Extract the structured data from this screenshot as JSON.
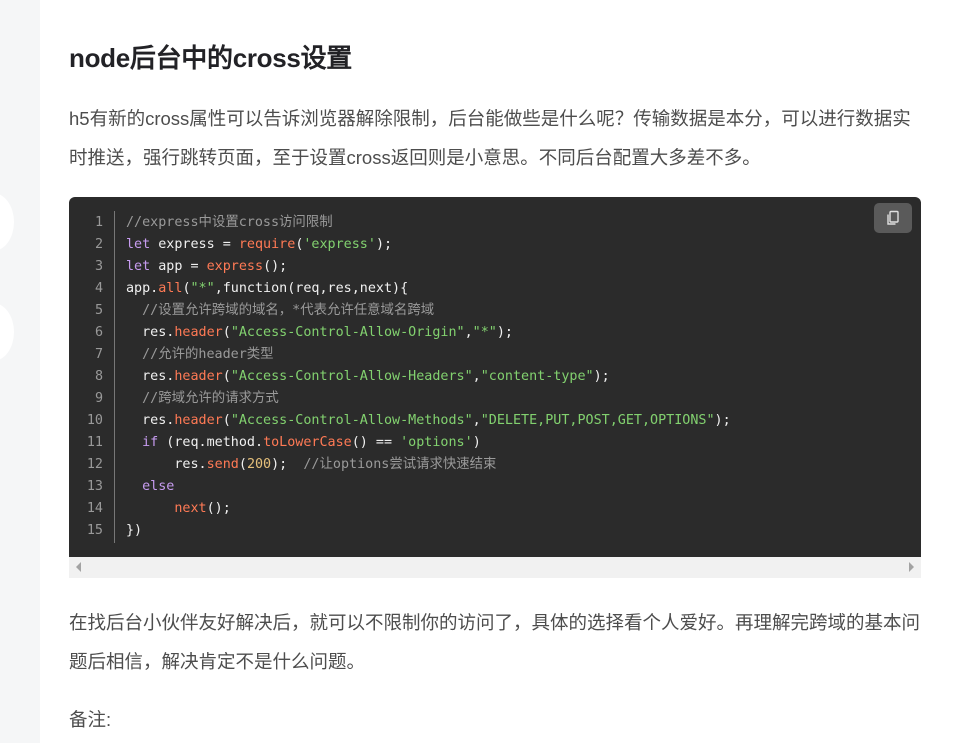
{
  "article": {
    "title": "node后台中的cross设置",
    "intro": "h5有新的cross属性可以告诉浏览器解除限制，后台能做些是什么呢？传输数据是本分，可以进行数据实时推送，强行跳转页面，至于设置cross返回则是小意思。不同后台配置大多差不多。",
    "conclusion": "在找后台小伙伴友好解决后，就可以不限制你的访问了，具体的选择看个人爱好。再理解完跨域的基本问题后相信，解决肯定不是什么问题。",
    "note_label": "备注:"
  },
  "code_block": {
    "copy_icon": "copy-icon",
    "lines": [
      {
        "n": "1",
        "tokens": [
          [
            "cm",
            "//express中设置cross访问限制"
          ]
        ]
      },
      {
        "n": "2",
        "tokens": [
          [
            "kw",
            "let"
          ],
          [
            "pl",
            " express = "
          ],
          [
            "fn",
            "require"
          ],
          [
            "pl",
            "("
          ],
          [
            "st",
            "'express'"
          ],
          [
            "pl",
            ");"
          ]
        ]
      },
      {
        "n": "3",
        "tokens": [
          [
            "kw",
            "let"
          ],
          [
            "pl",
            " app = "
          ],
          [
            "fn",
            "express"
          ],
          [
            "pl",
            "();"
          ]
        ]
      },
      {
        "n": "4",
        "tokens": [
          [
            "pl",
            "app."
          ],
          [
            "fn",
            "all"
          ],
          [
            "pl",
            "("
          ],
          [
            "st",
            "\"*\""
          ],
          [
            "pl",
            ",function(req,res,next){"
          ]
        ]
      },
      {
        "n": "5",
        "tokens": [
          [
            "pl",
            "  "
          ],
          [
            "cm",
            "//设置允许跨域的域名，*代表允许任意域名跨域"
          ]
        ]
      },
      {
        "n": "6",
        "tokens": [
          [
            "pl",
            "  res."
          ],
          [
            "fn",
            "header"
          ],
          [
            "pl",
            "("
          ],
          [
            "st",
            "\"Access-Control-Allow-Origin\""
          ],
          [
            "pl",
            ","
          ],
          [
            "st",
            "\"*\""
          ],
          [
            "pl",
            ");"
          ]
        ]
      },
      {
        "n": "7",
        "tokens": [
          [
            "pl",
            "  "
          ],
          [
            "cm",
            "//允许的header类型"
          ]
        ]
      },
      {
        "n": "8",
        "tokens": [
          [
            "pl",
            "  res."
          ],
          [
            "fn",
            "header"
          ],
          [
            "pl",
            "("
          ],
          [
            "st",
            "\"Access-Control-Allow-Headers\""
          ],
          [
            "pl",
            ","
          ],
          [
            "st",
            "\"content-type\""
          ],
          [
            "pl",
            ");"
          ]
        ]
      },
      {
        "n": "9",
        "tokens": [
          [
            "pl",
            "  "
          ],
          [
            "cm",
            "//跨域允许的请求方式"
          ]
        ]
      },
      {
        "n": "10",
        "tokens": [
          [
            "pl",
            "  res."
          ],
          [
            "fn",
            "header"
          ],
          [
            "pl",
            "("
          ],
          [
            "st",
            "\"Access-Control-Allow-Methods\""
          ],
          [
            "pl",
            ","
          ],
          [
            "st",
            "\"DELETE,PUT,POST,GET,OPTIONS\""
          ],
          [
            "pl",
            ");"
          ]
        ]
      },
      {
        "n": "11",
        "tokens": [
          [
            "pl",
            "  "
          ],
          [
            "kw",
            "if"
          ],
          [
            "pl",
            " (req.method."
          ],
          [
            "fn",
            "toLowerCase"
          ],
          [
            "pl",
            "() == "
          ],
          [
            "st",
            "'options'"
          ],
          [
            "pl",
            ")"
          ]
        ]
      },
      {
        "n": "12",
        "tokens": [
          [
            "pl",
            "      res."
          ],
          [
            "fn",
            "send"
          ],
          [
            "pl",
            "("
          ],
          [
            "nu",
            "200"
          ],
          [
            "pl",
            ");  "
          ],
          [
            "cm",
            "//让options尝试请求快速结束"
          ]
        ]
      },
      {
        "n": "13",
        "tokens": [
          [
            "pl",
            "  "
          ],
          [
            "kw",
            "else"
          ]
        ]
      },
      {
        "n": "14",
        "tokens": [
          [
            "pl",
            "      "
          ],
          [
            "fn",
            "next"
          ],
          [
            "pl",
            "();"
          ]
        ]
      },
      {
        "n": "15",
        "tokens": [
          [
            "pl",
            "})"
          ]
        ]
      }
    ]
  }
}
